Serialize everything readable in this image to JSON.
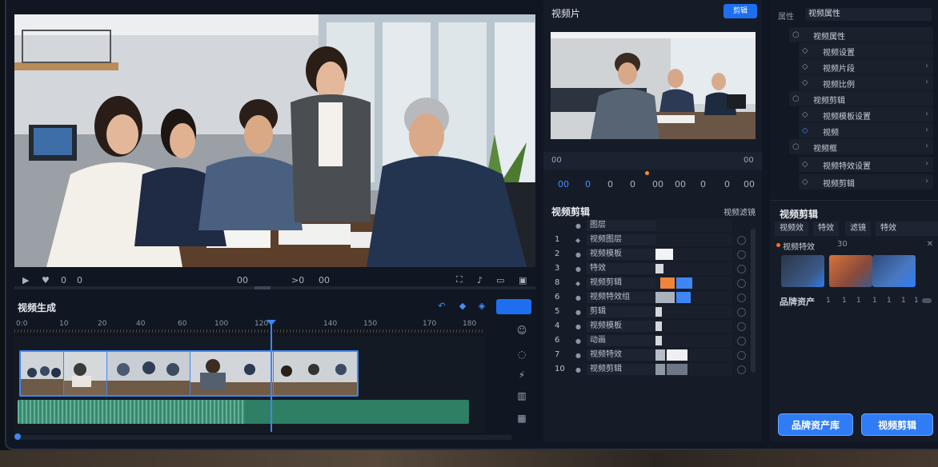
{
  "preview": {
    "transport": {
      "time_left": "0",
      "time_mid1": "00",
      "time_mid2": ">0",
      "time_mid3": "00"
    }
  },
  "timeline": {
    "title": "视频生成",
    "ruler_labels": [
      "0:0",
      "10",
      "20",
      "40",
      "60",
      "100",
      "120",
      "140",
      "150",
      "170",
      "180"
    ]
  },
  "mid_panel": {
    "title": "视频片",
    "button_label": "剪辑",
    "strip_labels": [
      "00",
      "00"
    ],
    "toolbar_labels": [
      "00",
      "0",
      "0",
      "0",
      "00",
      "00",
      "0",
      "0",
      "00"
    ],
    "layers_title": "视频剪辑",
    "layers_right": "视频滤镜",
    "layers": [
      {
        "num": "",
        "name": "图层"
      },
      {
        "num": "1",
        "name": "视频图层"
      },
      {
        "num": "2",
        "name": "视频模板"
      },
      {
        "num": "3",
        "name": "特效"
      },
      {
        "num": "8",
        "name": "视频剪辑"
      },
      {
        "num": "6",
        "name": "视频特效组"
      },
      {
        "num": "5",
        "name": "剪辑"
      },
      {
        "num": "4",
        "name": "视频模板"
      },
      {
        "num": "6",
        "name": "动画"
      },
      {
        "num": "7",
        "name": "视频特效"
      },
      {
        "num": "10",
        "name": "视频剪辑"
      }
    ]
  },
  "right_panel": {
    "top_label": "属性",
    "top_select": "视频属性",
    "props": [
      {
        "label": "视频属性",
        "icon": "○",
        "chev": ""
      },
      {
        "label": "视频设置",
        "icon": "◇",
        "chev": ""
      },
      {
        "label": "视频片段",
        "icon": "◇",
        "chev": "›"
      },
      {
        "label": "视频比例",
        "icon": "◇",
        "chev": "›"
      },
      {
        "label": "视频剪辑",
        "icon": "○",
        "chev": ""
      },
      {
        "label": "视频模板设置",
        "icon": "◇",
        "chev": "›"
      },
      {
        "label": "视频",
        "icon": "◇",
        "chev": "›"
      },
      {
        "label": "视频框",
        "icon": "○",
        "chev": "›"
      },
      {
        "label": "视频特效设置",
        "icon": "◇",
        "chev": "›"
      },
      {
        "label": "视频剪辑",
        "icon": "◇",
        "chev": "›"
      }
    ],
    "section_title": "视频剪辑",
    "tabs": [
      "视频效",
      "特效",
      "滤镜",
      "特效"
    ],
    "sub_label": "视频特效",
    "sub_value": "30",
    "bar_label": "品牌资产",
    "bar_ticks": [
      "1",
      "1",
      "1",
      "1",
      "1",
      "1",
      "1"
    ],
    "cta_primary": "品牌资产库",
    "cta_secondary": "视频剪辑"
  },
  "colors": {
    "accent": "#2f7cf6",
    "audio": "#2e7f64",
    "warning": "#ff8a2a"
  }
}
